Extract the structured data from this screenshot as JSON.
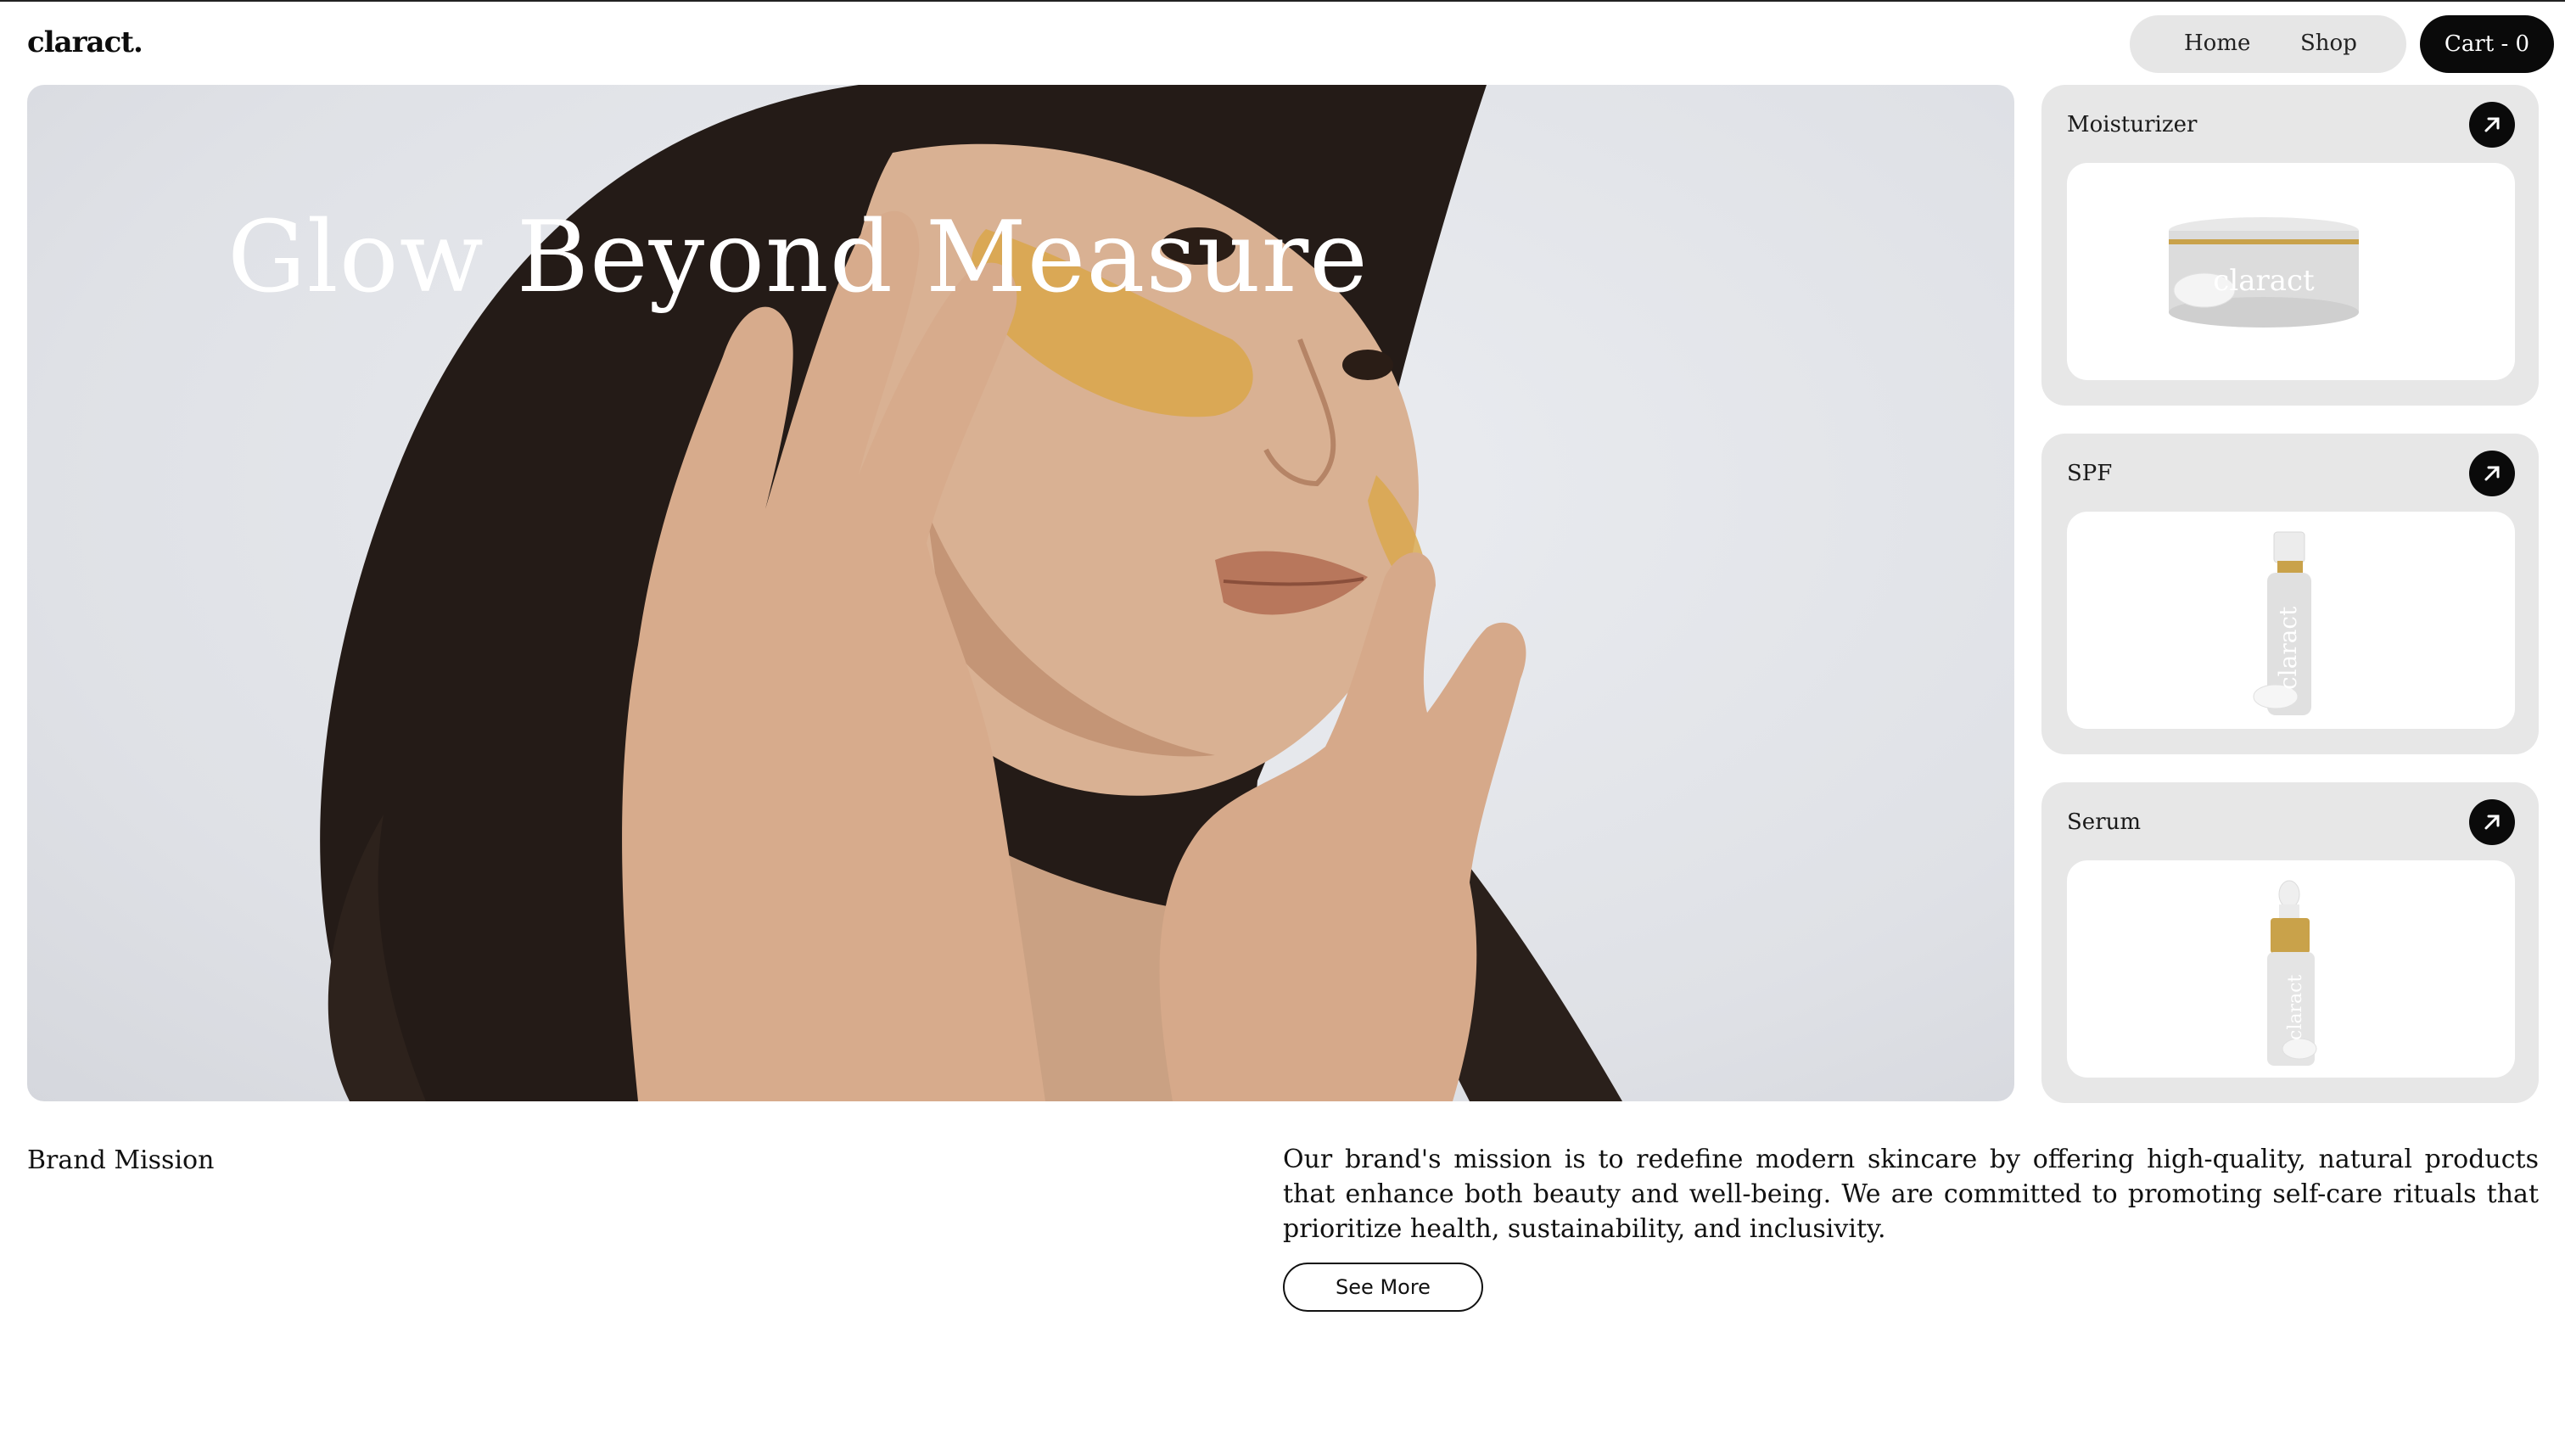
{
  "header": {
    "logo": "claract.",
    "nav": [
      {
        "label": "Home"
      },
      {
        "label": "Shop"
      }
    ],
    "cart_label": "Cart - 0"
  },
  "hero": {
    "title": "Glow Beyond Measure"
  },
  "products": [
    {
      "name": "Moisturizer",
      "image_brand": "claract",
      "icon": "arrow-up-right-icon"
    },
    {
      "name": "SPF",
      "image_brand": "claract",
      "icon": "arrow-up-right-icon"
    },
    {
      "name": "Serum",
      "image_brand": "claract",
      "icon": "arrow-up-right-icon"
    }
  ],
  "mission": {
    "heading": "Brand Mission",
    "text": "Our brand's mission is to redefine modern skincare by offering high-quality, natural products that enhance both beauty and well-being. We are committed to promoting self-care rituals that prioritize health, sustainability, and inclusivity.",
    "button_label": "See More"
  },
  "colors": {
    "accent": "#0a0a0a",
    "card_bg": "#e7e7e7",
    "nav_bg": "#e6e6e6",
    "gold": "#c9a24a"
  }
}
